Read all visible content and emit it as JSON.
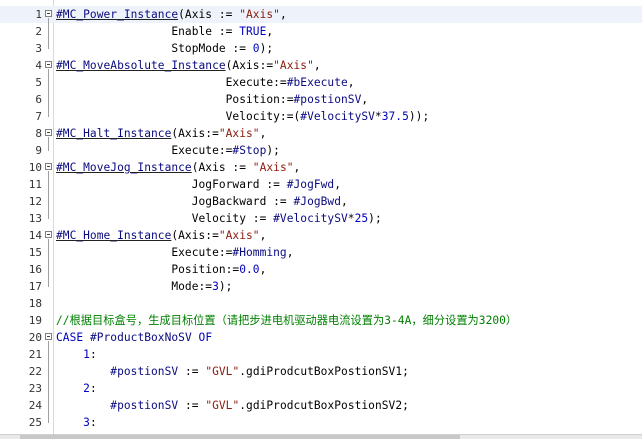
{
  "editor": {
    "lines": [
      {
        "num": "1",
        "fold": true,
        "segs": [
          {
            "t": "#MC_Power_Instance",
            "c": "v inst"
          },
          {
            "t": "(Axis := ",
            "c": "p"
          },
          {
            "t": "\"Axis\"",
            "c": "s"
          },
          {
            "t": ",",
            "c": "p"
          }
        ]
      },
      {
        "num": "2",
        "fold": false,
        "segs": [
          {
            "t": "                 Enable := ",
            "c": "p"
          },
          {
            "t": "TRUE",
            "c": "kw"
          },
          {
            "t": ",",
            "c": "p"
          }
        ]
      },
      {
        "num": "3",
        "fold": false,
        "segs": [
          {
            "t": "                 StopMode := ",
            "c": "p"
          },
          {
            "t": "0",
            "c": "n"
          },
          {
            "t": ");",
            "c": "p"
          }
        ]
      },
      {
        "num": "4",
        "fold": true,
        "segs": [
          {
            "t": "#MC_MoveAbsolute_Instance",
            "c": "v inst"
          },
          {
            "t": "(Axis:=",
            "c": "p"
          },
          {
            "t": "\"Axis\"",
            "c": "s"
          },
          {
            "t": ",",
            "c": "p"
          }
        ]
      },
      {
        "num": "5",
        "fold": false,
        "segs": [
          {
            "t": "                         Execute:=",
            "c": "p"
          },
          {
            "t": "#bExecute",
            "c": "v"
          },
          {
            "t": ",",
            "c": "p"
          }
        ]
      },
      {
        "num": "6",
        "fold": false,
        "segs": [
          {
            "t": "                         Position:=",
            "c": "p"
          },
          {
            "t": "#postionSV",
            "c": "v"
          },
          {
            "t": ",",
            "c": "p"
          }
        ]
      },
      {
        "num": "7",
        "fold": false,
        "segs": [
          {
            "t": "                         Velocity:=(",
            "c": "p"
          },
          {
            "t": "#VelocitySV",
            "c": "v"
          },
          {
            "t": "*",
            "c": "p"
          },
          {
            "t": "37.5",
            "c": "n"
          },
          {
            "t": "));",
            "c": "p"
          }
        ]
      },
      {
        "num": "8",
        "fold": true,
        "segs": [
          {
            "t": "#MC_Halt_Instance",
            "c": "v inst"
          },
          {
            "t": "(Axis:=",
            "c": "p"
          },
          {
            "t": "\"Axis\"",
            "c": "s"
          },
          {
            "t": ",",
            "c": "p"
          }
        ]
      },
      {
        "num": "9",
        "fold": false,
        "segs": [
          {
            "t": "                 Execute:=",
            "c": "p"
          },
          {
            "t": "#Stop",
            "c": "v"
          },
          {
            "t": ");",
            "c": "p"
          }
        ]
      },
      {
        "num": "10",
        "fold": true,
        "segs": [
          {
            "t": "#MC_MoveJog_Instance",
            "c": "v inst"
          },
          {
            "t": "(Axis := ",
            "c": "p"
          },
          {
            "t": "\"Axis\"",
            "c": "s"
          },
          {
            "t": ",",
            "c": "p"
          }
        ]
      },
      {
        "num": "11",
        "fold": false,
        "segs": [
          {
            "t": "                    JogForward := ",
            "c": "p"
          },
          {
            "t": "#JogFwd",
            "c": "v"
          },
          {
            "t": ",",
            "c": "p"
          }
        ]
      },
      {
        "num": "12",
        "fold": false,
        "segs": [
          {
            "t": "                    JogBackward := ",
            "c": "p"
          },
          {
            "t": "#JogBwd",
            "c": "v"
          },
          {
            "t": ",",
            "c": "p"
          }
        ]
      },
      {
        "num": "13",
        "fold": false,
        "segs": [
          {
            "t": "                    Velocity := ",
            "c": "p"
          },
          {
            "t": "#VelocitySV",
            "c": "v"
          },
          {
            "t": "*",
            "c": "p"
          },
          {
            "t": "25",
            "c": "n"
          },
          {
            "t": ");",
            "c": "p"
          }
        ]
      },
      {
        "num": "14",
        "fold": true,
        "segs": [
          {
            "t": "#MC_Home_Instance",
            "c": "v inst"
          },
          {
            "t": "(Axis:=",
            "c": "p"
          },
          {
            "t": "\"Axis\"",
            "c": "s"
          },
          {
            "t": ",",
            "c": "p"
          }
        ]
      },
      {
        "num": "15",
        "fold": false,
        "segs": [
          {
            "t": "                 Execute:=",
            "c": "p"
          },
          {
            "t": "#Homming",
            "c": "v"
          },
          {
            "t": ",",
            "c": "p"
          }
        ]
      },
      {
        "num": "16",
        "fold": false,
        "segs": [
          {
            "t": "                 Position:=",
            "c": "p"
          },
          {
            "t": "0.0",
            "c": "n"
          },
          {
            "t": ",",
            "c": "p"
          }
        ]
      },
      {
        "num": "17",
        "fold": false,
        "segs": [
          {
            "t": "                 Mode:=",
            "c": "p"
          },
          {
            "t": "3",
            "c": "n"
          },
          {
            "t": ");",
            "c": "p"
          }
        ]
      },
      {
        "num": "18",
        "fold": false,
        "segs": []
      },
      {
        "num": "19",
        "fold": false,
        "segs": [
          {
            "t": "//根据目标盒号，生成目标位置（请把步进电机驱动器电流设置为3-4A，细分设置为3200）",
            "c": "cm"
          }
        ]
      },
      {
        "num": "20",
        "fold": true,
        "segs": [
          {
            "t": "CASE",
            "c": "kw"
          },
          {
            "t": " ",
            "c": "p"
          },
          {
            "t": "#ProductBoxNoSV",
            "c": "v"
          },
          {
            "t": " ",
            "c": "p"
          },
          {
            "t": "OF",
            "c": "kw"
          }
        ]
      },
      {
        "num": "21",
        "fold": false,
        "segs": [
          {
            "t": "    ",
            "c": "p"
          },
          {
            "t": "1",
            "c": "n"
          },
          {
            "t": ":",
            "c": "p"
          }
        ]
      },
      {
        "num": "22",
        "fold": false,
        "segs": [
          {
            "t": "        ",
            "c": "p"
          },
          {
            "t": "#postionSV",
            "c": "v"
          },
          {
            "t": " := ",
            "c": "p"
          },
          {
            "t": "\"GVL\"",
            "c": "s"
          },
          {
            "t": ".gdiProdcutBoxPostionSV1;",
            "c": "p"
          }
        ]
      },
      {
        "num": "23",
        "fold": false,
        "segs": [
          {
            "t": "    ",
            "c": "p"
          },
          {
            "t": "2",
            "c": "n"
          },
          {
            "t": ":",
            "c": "p"
          }
        ]
      },
      {
        "num": "24",
        "fold": false,
        "segs": [
          {
            "t": "        ",
            "c": "p"
          },
          {
            "t": "#postionSV",
            "c": "v"
          },
          {
            "t": " := ",
            "c": "p"
          },
          {
            "t": "\"GVL\"",
            "c": "s"
          },
          {
            "t": ".gdiProdcutBoxPostionSV2;",
            "c": "p"
          }
        ]
      },
      {
        "num": "25",
        "fold": false,
        "segs": [
          {
            "t": "    ",
            "c": "p"
          },
          {
            "t": "3",
            "c": "n"
          },
          {
            "t": ":",
            "c": "p"
          }
        ]
      }
    ],
    "active_line": "1"
  },
  "colors": {
    "variable": "#0a0a80",
    "string": "#8a1a0a",
    "keyword": "#0000c0",
    "comment": "#008000",
    "active_line_bg": "#eef3fb"
  },
  "icons": {
    "fold_marker": "fold-collapse-icon"
  }
}
